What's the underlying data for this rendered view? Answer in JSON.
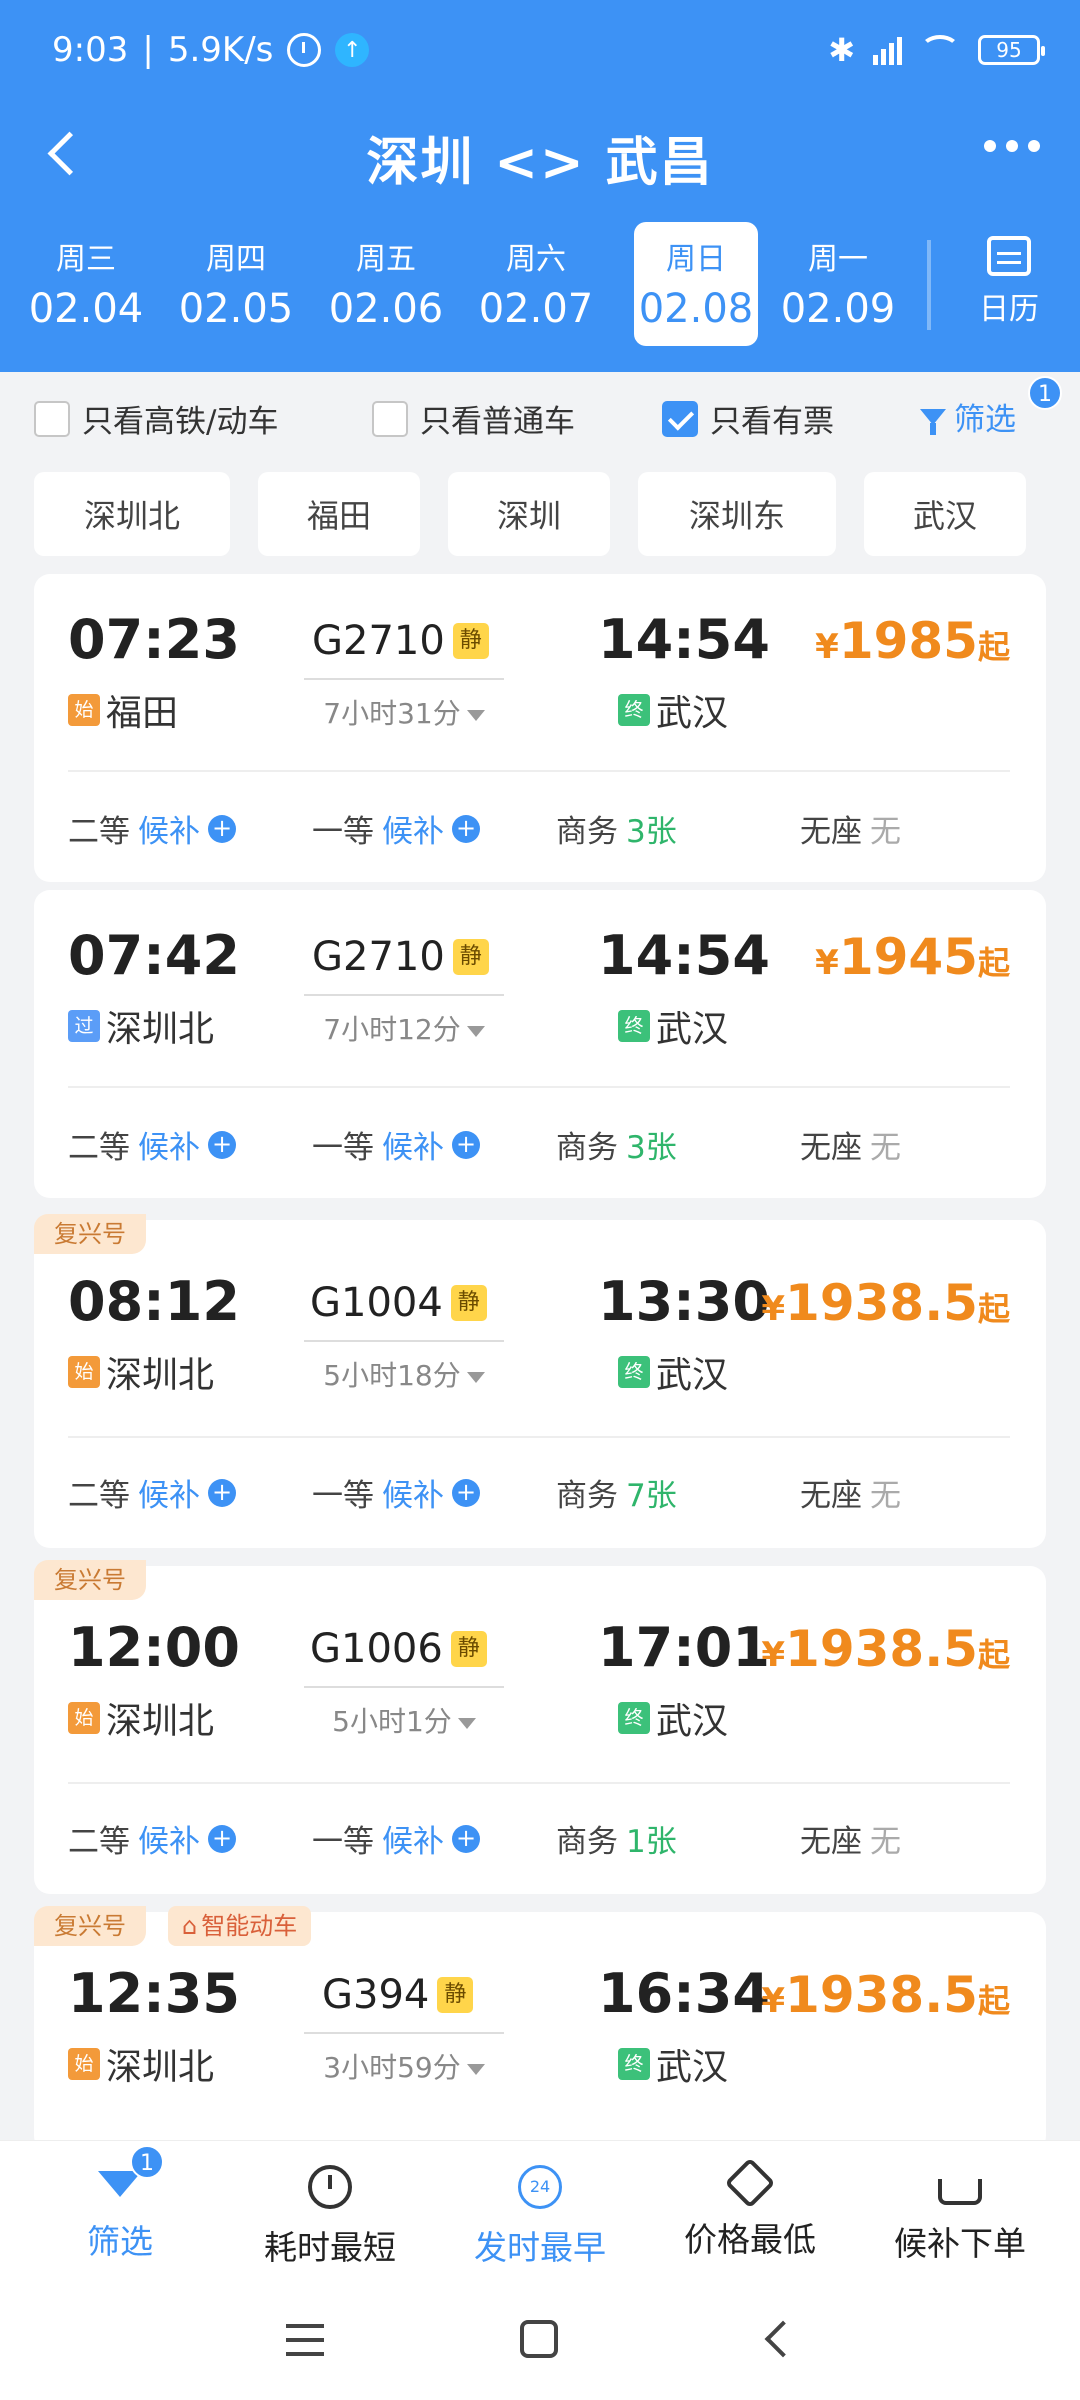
{
  "status": {
    "time": "9:03",
    "speed": "5.9K/s",
    "battery": "95"
  },
  "nav": {
    "title": "深圳 <> 武昌"
  },
  "dates": [
    {
      "weekday": "周三",
      "date": "02.04"
    },
    {
      "weekday": "周四",
      "date": "02.05"
    },
    {
      "weekday": "周五",
      "date": "02.06"
    },
    {
      "weekday": "周六",
      "date": "02.07"
    },
    {
      "weekday": "周日",
      "date": "02.08"
    },
    {
      "weekday": "周一",
      "date": "02.09"
    }
  ],
  "calendar_label": "日历",
  "filters": {
    "high_speed": "只看高铁/动车",
    "normal": "只看普通车",
    "available": "只看有票",
    "filter": "筛选",
    "filter_count": "1"
  },
  "stations": [
    "深圳北",
    "福田",
    "深圳",
    "深圳东",
    "武汉"
  ],
  "trains": [
    {
      "dep_time": "07:23",
      "dep_mark": "始",
      "dep_station": "福田",
      "train_no": "G2710",
      "quiet": "静",
      "duration": "7小时31分",
      "arr_time": "14:54",
      "arr_mark": "终",
      "arr_station": "武汉",
      "price_symbol": "¥",
      "price": "1985",
      "price_suffix": "起",
      "seats": {
        "second": "二等",
        "second_val": "候补",
        "first": "一等",
        "first_val": "候补",
        "business": "商务",
        "business_val": "3张",
        "none": "无座",
        "none_val": "无"
      }
    },
    {
      "dep_time": "07:42",
      "dep_mark": "过",
      "dep_station": "深圳北",
      "train_no": "G2710",
      "quiet": "静",
      "duration": "7小时12分",
      "arr_time": "14:54",
      "arr_mark": "终",
      "arr_station": "武汉",
      "price_symbol": "¥",
      "price": "1945",
      "price_suffix": "起",
      "seats": {
        "second": "二等",
        "second_val": "候补",
        "first": "一等",
        "first_val": "候补",
        "business": "商务",
        "business_val": "3张",
        "none": "无座",
        "none_val": "无"
      }
    },
    {
      "tag": "复兴号",
      "dep_time": "08:12",
      "dep_mark": "始",
      "dep_station": "深圳北",
      "train_no": "G1004",
      "quiet": "静",
      "duration": "5小时18分",
      "arr_time": "13:30",
      "arr_mark": "终",
      "arr_station": "武汉",
      "price_symbol": "¥",
      "price": "1938.5",
      "price_suffix": "起",
      "seats": {
        "second": "二等",
        "second_val": "候补",
        "first": "一等",
        "first_val": "候补",
        "business": "商务",
        "business_val": "7张",
        "none": "无座",
        "none_val": "无"
      }
    },
    {
      "tag": "复兴号",
      "dep_time": "12:00",
      "dep_mark": "始",
      "dep_station": "深圳北",
      "train_no": "G1006",
      "quiet": "静",
      "duration": "5小时1分",
      "arr_time": "17:01",
      "arr_mark": "终",
      "arr_station": "武汉",
      "price_symbol": "¥",
      "price": "1938.5",
      "price_suffix": "起",
      "seats": {
        "second": "二等",
        "second_val": "候补",
        "first": "一等",
        "first_val": "候补",
        "business": "商务",
        "business_val": "1张",
        "none": "无座",
        "none_val": "无"
      }
    },
    {
      "tag": "复兴号",
      "tag2": "智能动车",
      "dep_time": "12:35",
      "dep_mark": "始",
      "dep_station": "深圳北",
      "train_no": "G394",
      "quiet": "静",
      "duration": "3小时59分",
      "arr_time": "16:34",
      "arr_mark": "终",
      "arr_station": "武汉",
      "price_symbol": "¥",
      "price": "1938.5",
      "price_suffix": "起"
    }
  ],
  "toolbar": {
    "filter": "筛选",
    "filter_count": "1",
    "shortest": "耗时最短",
    "earliest": "发时最早",
    "earliest_icon": "24",
    "cheapest": "价格最低",
    "waitlist": "候补下单"
  },
  "colors": {
    "primary": "#3d92f5",
    "price": "#f08a1d",
    "available": "#2fb56b"
  }
}
